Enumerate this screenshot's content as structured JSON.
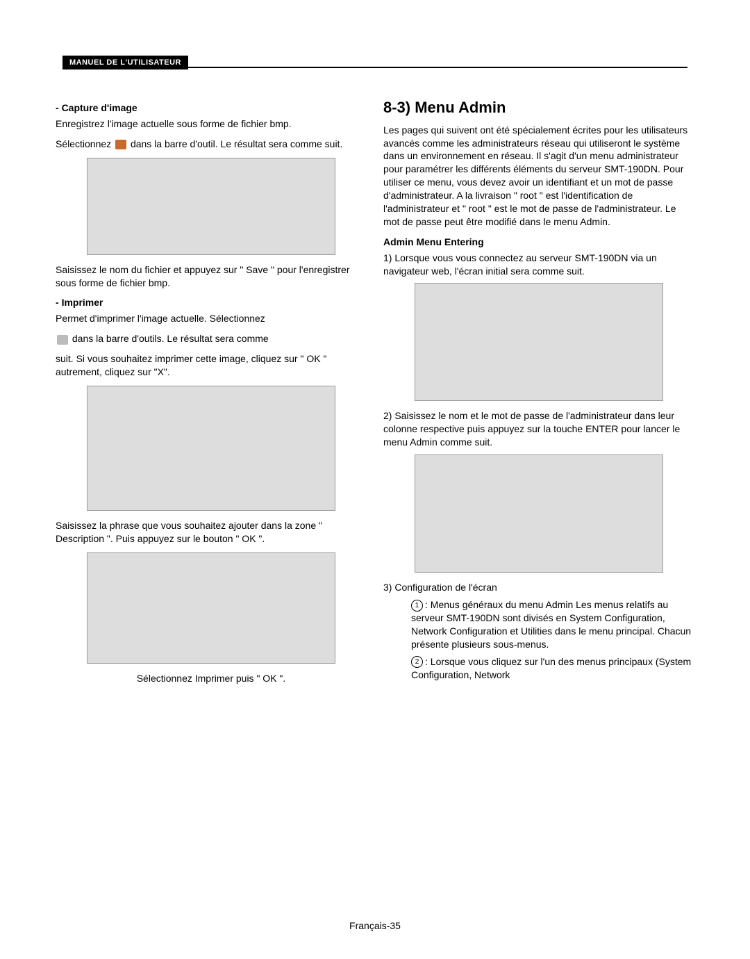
{
  "header": {
    "label": "MANUEL DE L'UTILISATEUR"
  },
  "left": {
    "capture": {
      "title": "Capture d'image",
      "p1a": "Enregistrez l'image actuelle sous forme de fichier bmp.",
      "p1b_pre": "Sélectionnez ",
      "p1b_post": " dans la barre d'outil. Le résultat sera comme suit.",
      "p2": "Saisissez le nom du fichier et appuyez sur \" Save \" pour l'enregistrer sous forme de fichier bmp."
    },
    "imprimer": {
      "title": "Imprimer",
      "p1": "Permet d'imprimer l'image actuelle. Sélectionnez",
      "p1b_post": " dans la barre d'outils. Le résultat sera comme",
      "p1c": "suit. Si vous souhaitez imprimer cette image, cliquez sur \" OK \" autrement, cliquez sur \"X\".",
      "p2": "Saisissez la phrase que vous souhaitez ajouter dans la zone \" Description \". Puis appuyez sur le bouton \" OK \".",
      "p3": "Sélectionnez Imprimer puis \" OK \"."
    }
  },
  "right": {
    "menuadmin": {
      "title": "8-3) Menu Admin",
      "p1": "Les pages qui suivent ont été spécialement écrites pour les utilisateurs avancés comme les administrateurs réseau qui utiliseront le système dans un environnement en réseau. Il s'agit d'un menu administrateur pour paramétrer les différents éléments du serveur SMT-190DN. Pour utiliser ce menu, vous devez avoir un identifiant et un mot de passe d'administrateur. A la livraison \" root \" est l'identification de l'administrateur et \" root \" est le mot de passe de l'administrateur. Le mot de passe peut être modifié dans le menu Admin."
    },
    "entering": {
      "title": "Admin Menu Entering",
      "li1": "1) Lorsque vous vous connectez au serveur SMT-190DN via un navigateur web, l'écran initial sera comme suit.",
      "li2": "2)  Saisissez le nom et le mot de passe de l'administrateur dans leur colonne respective puis appuyez sur la touche ENTER pour lancer le menu Admin comme suit.",
      "li3": "3) Configuration de l'écran",
      "li3a": ": Menus généraux du menu Admin Les menus relatifs au serveur SMT-190DN sont divisés en System Configuration, Network Configuration et Utilities dans le menu principal. Chacun présente plusieurs sous-menus.",
      "li3b": ": Lorsque vous cliquez sur l'un des menus principaux (System Configuration, Network"
    }
  },
  "footer": {
    "pagenum": "Français-35"
  }
}
